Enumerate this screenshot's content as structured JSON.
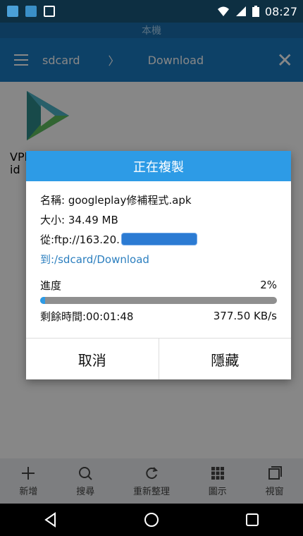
{
  "statusbar": {
    "time": "08:27"
  },
  "subheader": {
    "label": "本機"
  },
  "toolbar": {
    "crumb1": "sdcard",
    "crumb2": "Download",
    "arrow": "〉"
  },
  "content": {
    "file": {
      "name_line1": "VPlayer_V",
      "name_line2": "id"
    }
  },
  "bottom_toolbar": [
    {
      "label": "新增",
      "icon": "plus-icon"
    },
    {
      "label": "搜尋",
      "icon": "search-icon"
    },
    {
      "label": "重新整理",
      "icon": "refresh-icon"
    },
    {
      "label": "圖示",
      "icon": "grid-icon"
    },
    {
      "label": "視窗",
      "icon": "windows-icon"
    }
  ],
  "dialog": {
    "title": "正在複製",
    "name": "名稱: googleplay修補程式.apk",
    "size": "大小: 34.49 MB",
    "from_prefix": "從:ftp://163.20.",
    "to": "到:/sdcard/Download",
    "progress_label": "進度",
    "progress_pct": "2%",
    "progress_value": 0.02,
    "remaining": "剩餘時間:00:01:48",
    "speed": "377.50 KB/s",
    "cancel": "取消",
    "hide": "隱藏"
  },
  "colors": {
    "accent": "#2d9be6",
    "link": "#2c7fbf"
  }
}
